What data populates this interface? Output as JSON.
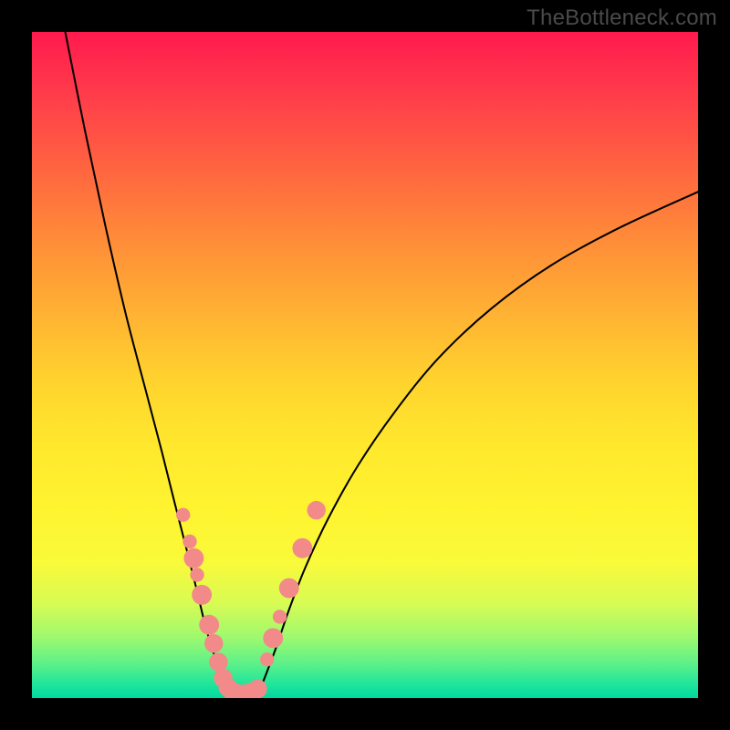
{
  "watermark": {
    "text": "TheBottleneck.com"
  },
  "chart_data": {
    "type": "line",
    "title": "",
    "xlabel": "",
    "ylabel": "",
    "xlim": [
      0,
      100
    ],
    "ylim": [
      0,
      100
    ],
    "grid": false,
    "legend": false,
    "series": [
      {
        "name": "curve-left",
        "x": [
          5,
          8,
          11,
          14,
          17,
          19.5,
          21.5,
          23.3,
          24.8,
          26,
          27.2,
          28.3,
          29.2,
          29.8
        ],
        "y": [
          100,
          85,
          71,
          58,
          46.5,
          37,
          29,
          22,
          16,
          11,
          7,
          3.8,
          1.7,
          0.6
        ]
      },
      {
        "name": "valley-floor",
        "x": [
          29.8,
          30.5,
          31.2,
          32.0,
          32.8,
          33.6
        ],
        "y": [
          0.6,
          0.25,
          0.15,
          0.15,
          0.25,
          0.55
        ]
      },
      {
        "name": "curve-right",
        "x": [
          33.6,
          34.5,
          35.5,
          36.8,
          38.5,
          41,
          44.5,
          49,
          54.5,
          61,
          69,
          78,
          88,
          100
        ],
        "y": [
          0.55,
          2.0,
          4.5,
          8,
          13,
          19.5,
          27,
          35,
          43,
          51,
          58.5,
          65,
          70.5,
          76
        ]
      }
    ],
    "dot_series": [
      {
        "name": "dots-left",
        "color": "#f28a8a",
        "points": [
          {
            "x": 22.7,
            "y": 27.5,
            "r": 1.05
          },
          {
            "x": 23.7,
            "y": 23.5,
            "r": 1.05
          },
          {
            "x": 24.3,
            "y": 21.0,
            "r": 1.5
          },
          {
            "x": 24.8,
            "y": 18.5,
            "r": 1.05
          },
          {
            "x": 25.5,
            "y": 15.5,
            "r": 1.5
          },
          {
            "x": 26.6,
            "y": 11.0,
            "r": 1.5
          },
          {
            "x": 27.3,
            "y": 8.2,
            "r": 1.4
          },
          {
            "x": 28.0,
            "y": 5.4,
            "r": 1.4
          }
        ]
      },
      {
        "name": "dots-valley",
        "color": "#f28a8a",
        "points": [
          {
            "x": 28.7,
            "y": 3.0,
            "r": 1.4
          },
          {
            "x": 29.4,
            "y": 1.6,
            "r": 1.4
          },
          {
            "x": 30.3,
            "y": 0.8,
            "r": 1.5
          },
          {
            "x": 31.2,
            "y": 0.6,
            "r": 1.4
          },
          {
            "x": 32.1,
            "y": 0.6,
            "r": 1.5
          },
          {
            "x": 33.0,
            "y": 0.8,
            "r": 1.5
          },
          {
            "x": 33.9,
            "y": 1.4,
            "r": 1.4
          }
        ]
      },
      {
        "name": "dots-right",
        "color": "#f28a8a",
        "points": [
          {
            "x": 35.3,
            "y": 5.8,
            "r": 1.05
          },
          {
            "x": 36.2,
            "y": 9.0,
            "r": 1.5
          },
          {
            "x": 37.2,
            "y": 12.2,
            "r": 1.05
          },
          {
            "x": 38.6,
            "y": 16.5,
            "r": 1.5
          },
          {
            "x": 40.6,
            "y": 22.5,
            "r": 1.5
          },
          {
            "x": 42.7,
            "y": 28.2,
            "r": 1.4
          }
        ]
      }
    ]
  }
}
